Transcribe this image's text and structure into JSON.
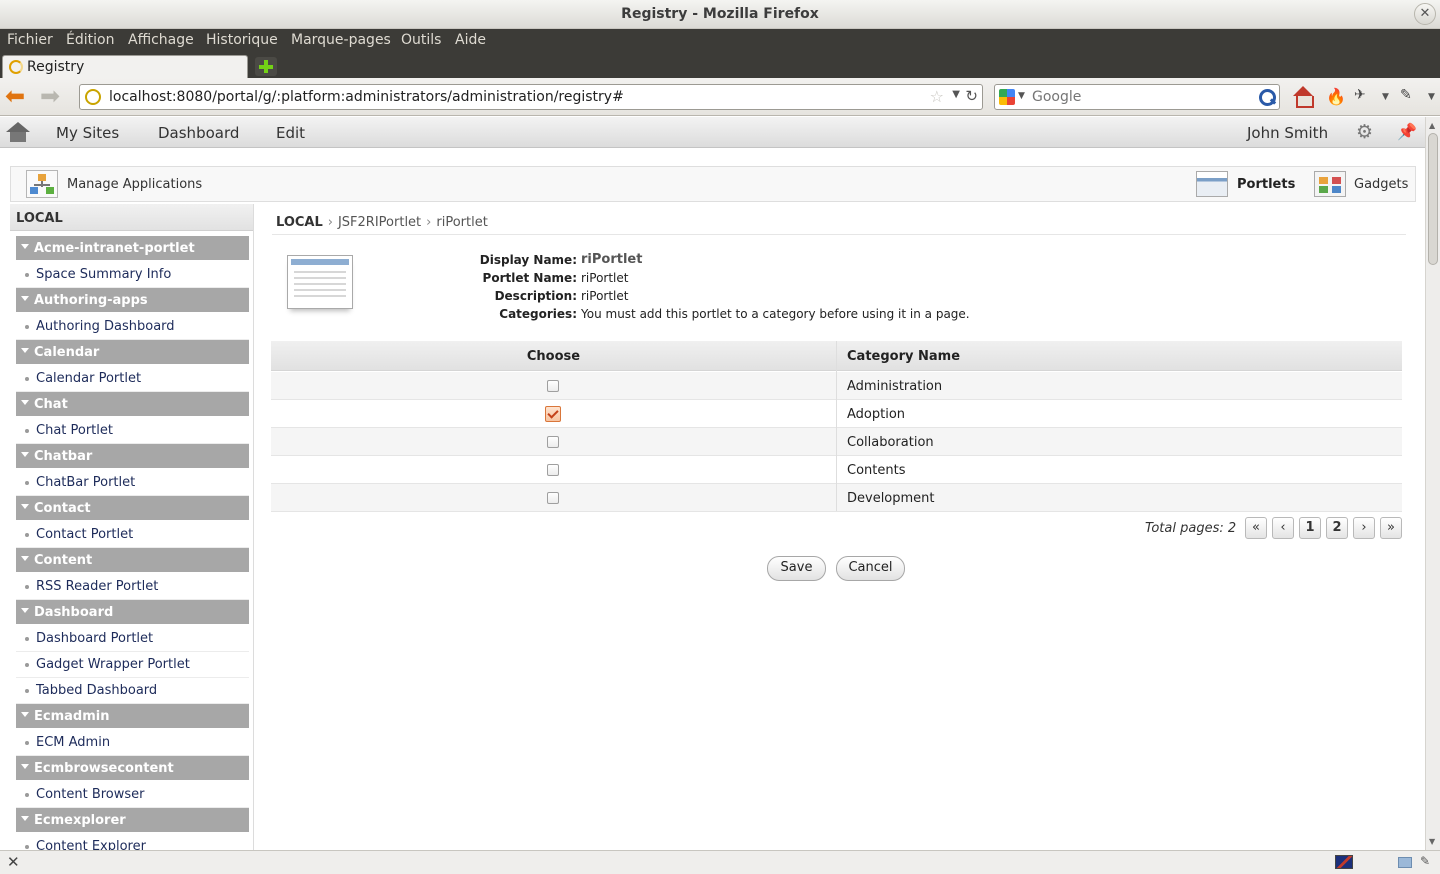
{
  "window": {
    "title": "Registry - Mozilla Firefox"
  },
  "menu": [
    {
      "label": "Fichier"
    },
    {
      "label": "Édition"
    },
    {
      "label": "Affichage"
    },
    {
      "label": "Historique"
    },
    {
      "label": "Marque-pages"
    },
    {
      "label": "Outils"
    },
    {
      "label": "Aide"
    }
  ],
  "tabs": [
    {
      "label": "Registry"
    }
  ],
  "navbar": {
    "url": "localhost:8080/portal/g/:platform:administrators/administration/registry#",
    "search_placeholder": "Google"
  },
  "portal_bar": {
    "items": [
      "My Sites",
      "Dashboard",
      "Edit"
    ],
    "user": "John Smith"
  },
  "app_header": {
    "title": "Manage Applications",
    "portlets_label": "Portlets",
    "gadgets_label": "Gadgets"
  },
  "sidebar": {
    "title": "LOCAL",
    "categories": [
      {
        "name": "Acme-intranet-portlet",
        "apps": [
          "Space Summary Info"
        ]
      },
      {
        "name": "Authoring-apps",
        "apps": [
          "Authoring Dashboard"
        ]
      },
      {
        "name": "Calendar",
        "apps": [
          "Calendar Portlet"
        ]
      },
      {
        "name": "Chat",
        "apps": [
          "Chat Portlet"
        ]
      },
      {
        "name": "Chatbar",
        "apps": [
          "ChatBar Portlet"
        ]
      },
      {
        "name": "Contact",
        "apps": [
          "Contact Portlet"
        ]
      },
      {
        "name": "Content",
        "apps": [
          "RSS Reader Portlet"
        ]
      },
      {
        "name": "Dashboard",
        "apps": [
          "Dashboard Portlet",
          "Gadget Wrapper Portlet",
          "Tabbed Dashboard"
        ]
      },
      {
        "name": "Ecmadmin",
        "apps": [
          "ECM Admin"
        ]
      },
      {
        "name": "Ecmbrowsecontent",
        "apps": [
          "Content Browser"
        ]
      },
      {
        "name": "Ecmexplorer",
        "apps": [
          "Content Explorer"
        ]
      }
    ]
  },
  "breadcrumb": [
    "LOCAL",
    "JSF2RIPortlet",
    "riPortlet"
  ],
  "details": {
    "display_name_label": "Display Name:",
    "display_name": "riPortlet",
    "portlet_name_label": "Portlet Name:",
    "portlet_name": "riPortlet",
    "description_label": "Description:",
    "description": "riPortlet",
    "categories_label": "Categories:",
    "categories": "You must add this portlet to a category before using it in a page."
  },
  "category_table": {
    "headers": {
      "choose": "Choose",
      "name": "Category Name"
    },
    "rows": [
      {
        "name": "Administration",
        "checked": false
      },
      {
        "name": "Adoption",
        "checked": true
      },
      {
        "name": "Collaboration",
        "checked": false
      },
      {
        "name": "Contents",
        "checked": false
      },
      {
        "name": "Development",
        "checked": false
      }
    ]
  },
  "pager": {
    "total_label": "Total pages: 2",
    "first": "«",
    "prev": "‹",
    "pages": [
      "1",
      "2"
    ],
    "next": "›",
    "last": "»"
  },
  "actions": {
    "save": "Save",
    "cancel": "Cancel"
  },
  "icons": {
    "back": "back-arrow-icon",
    "forward": "forward-arrow-icon",
    "home": "home-icon",
    "settings": "gear-icon",
    "pin": "pin-icon"
  },
  "colors": {
    "category_header": "#a7a7a7",
    "link": "#1d2b5a",
    "checked": "#d9763a"
  }
}
